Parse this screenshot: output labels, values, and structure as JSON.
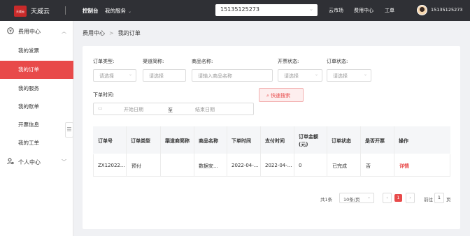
{
  "topbar": {
    "logo_text": "天威云",
    "brand": "天威云",
    "console": "控制台",
    "my_services": "我的服务",
    "account": "15135125273",
    "links": [
      "云市场",
      "费用中心",
      "工单"
    ],
    "username": "15135125273"
  },
  "sidebar": {
    "group1": {
      "label": "费用中心",
      "icon": "yen-circle-icon"
    },
    "items": [
      "我的发票",
      "我的订单",
      "我的服务",
      "我的账单",
      "开票信息",
      "我的工单"
    ],
    "active_index": 1,
    "group2": {
      "label": "个人中心",
      "icon": "user-settings-icon"
    }
  },
  "breadcrumb": [
    "费用中心",
    "我的订单"
  ],
  "filters": {
    "order_type_label": "订单类型:",
    "order_type_placeholder": "请选择",
    "channel_label": "渠道简称:",
    "channel_placeholder": "请选择",
    "product_label": "商品名称:",
    "product_placeholder": "请输入商品名称",
    "invoice_status_label": "开票状态:",
    "invoice_status_placeholder": "请选择",
    "order_status_label": "订单状态:",
    "order_status_placeholder": "请选择",
    "order_time_label": "下单时间:",
    "start_date": "开始日期",
    "to": "至",
    "end_date": "结束日期",
    "search_button": "快速搜索"
  },
  "table": {
    "headers": [
      "订单号",
      "订单类型",
      "渠道商简称",
      "商品名称",
      "下单时间",
      "支付时间",
      "订单金额(元)",
      "订单状态",
      "是否开票",
      "操作"
    ],
    "rows": [
      [
        "ZX12022...",
        "预付",
        "",
        "数据安...",
        "2022-04-...",
        "2022-04-...",
        "0",
        "已完成",
        "否",
        "详情"
      ]
    ]
  },
  "pagination": {
    "total": "共1条",
    "page_size": "10条/页",
    "current": "1",
    "goto_label": "前往",
    "goto_value": "1",
    "page_unit": "页"
  },
  "colors": {
    "accent": "#e84a4a",
    "topbar": "#2f3035"
  }
}
